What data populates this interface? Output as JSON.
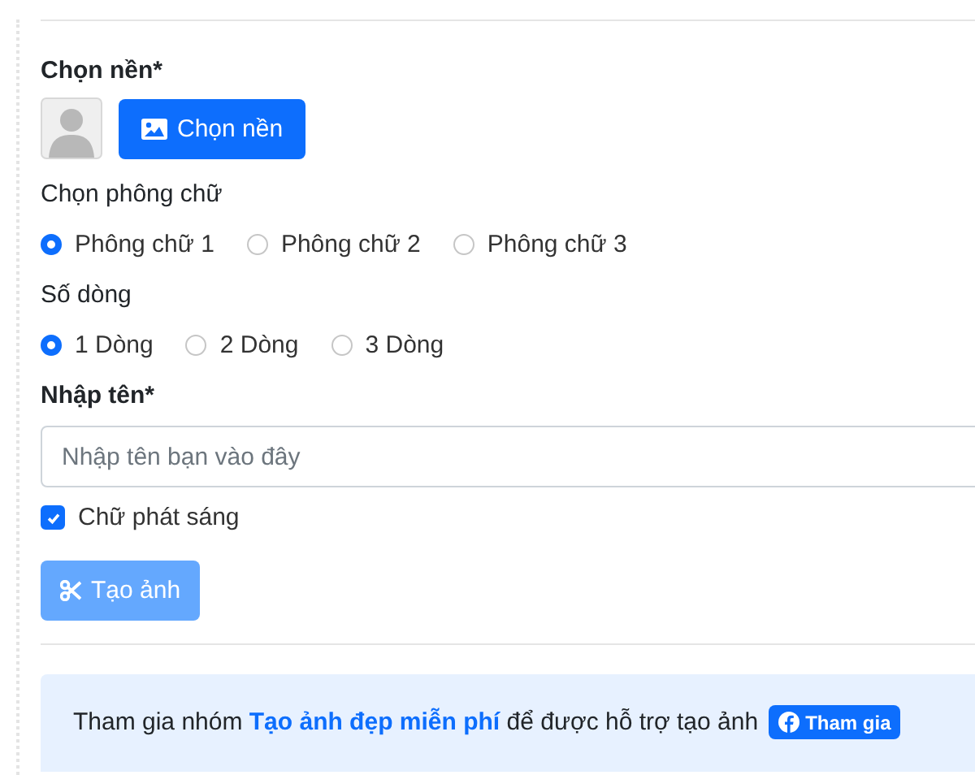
{
  "background": {
    "label": "Chọn nền*",
    "button": "Chọn nền"
  },
  "font": {
    "label": "Chọn phông chữ",
    "options": [
      {
        "label": "Phông chữ 1",
        "selected": true
      },
      {
        "label": "Phông chữ 2",
        "selected": false
      },
      {
        "label": "Phông chữ 3",
        "selected": false
      }
    ]
  },
  "lines": {
    "label": "Số dòng",
    "options": [
      {
        "label": "1 Dòng",
        "selected": true
      },
      {
        "label": "2 Dòng",
        "selected": false
      },
      {
        "label": "3 Dòng",
        "selected": false
      }
    ]
  },
  "name": {
    "label": "Nhập tên*",
    "placeholder": "Nhập tên bạn vào đây"
  },
  "glow": {
    "label": "Chữ phát sáng",
    "checked": true
  },
  "submit": {
    "label": "Tạo ảnh",
    "disabled": true
  },
  "notice": {
    "text": "Tham gia nhóm **Tạo ảnh đẹp miễn phí** để được hỗ trợ tạo ảnh",
    "button": "Tham gia"
  }
}
